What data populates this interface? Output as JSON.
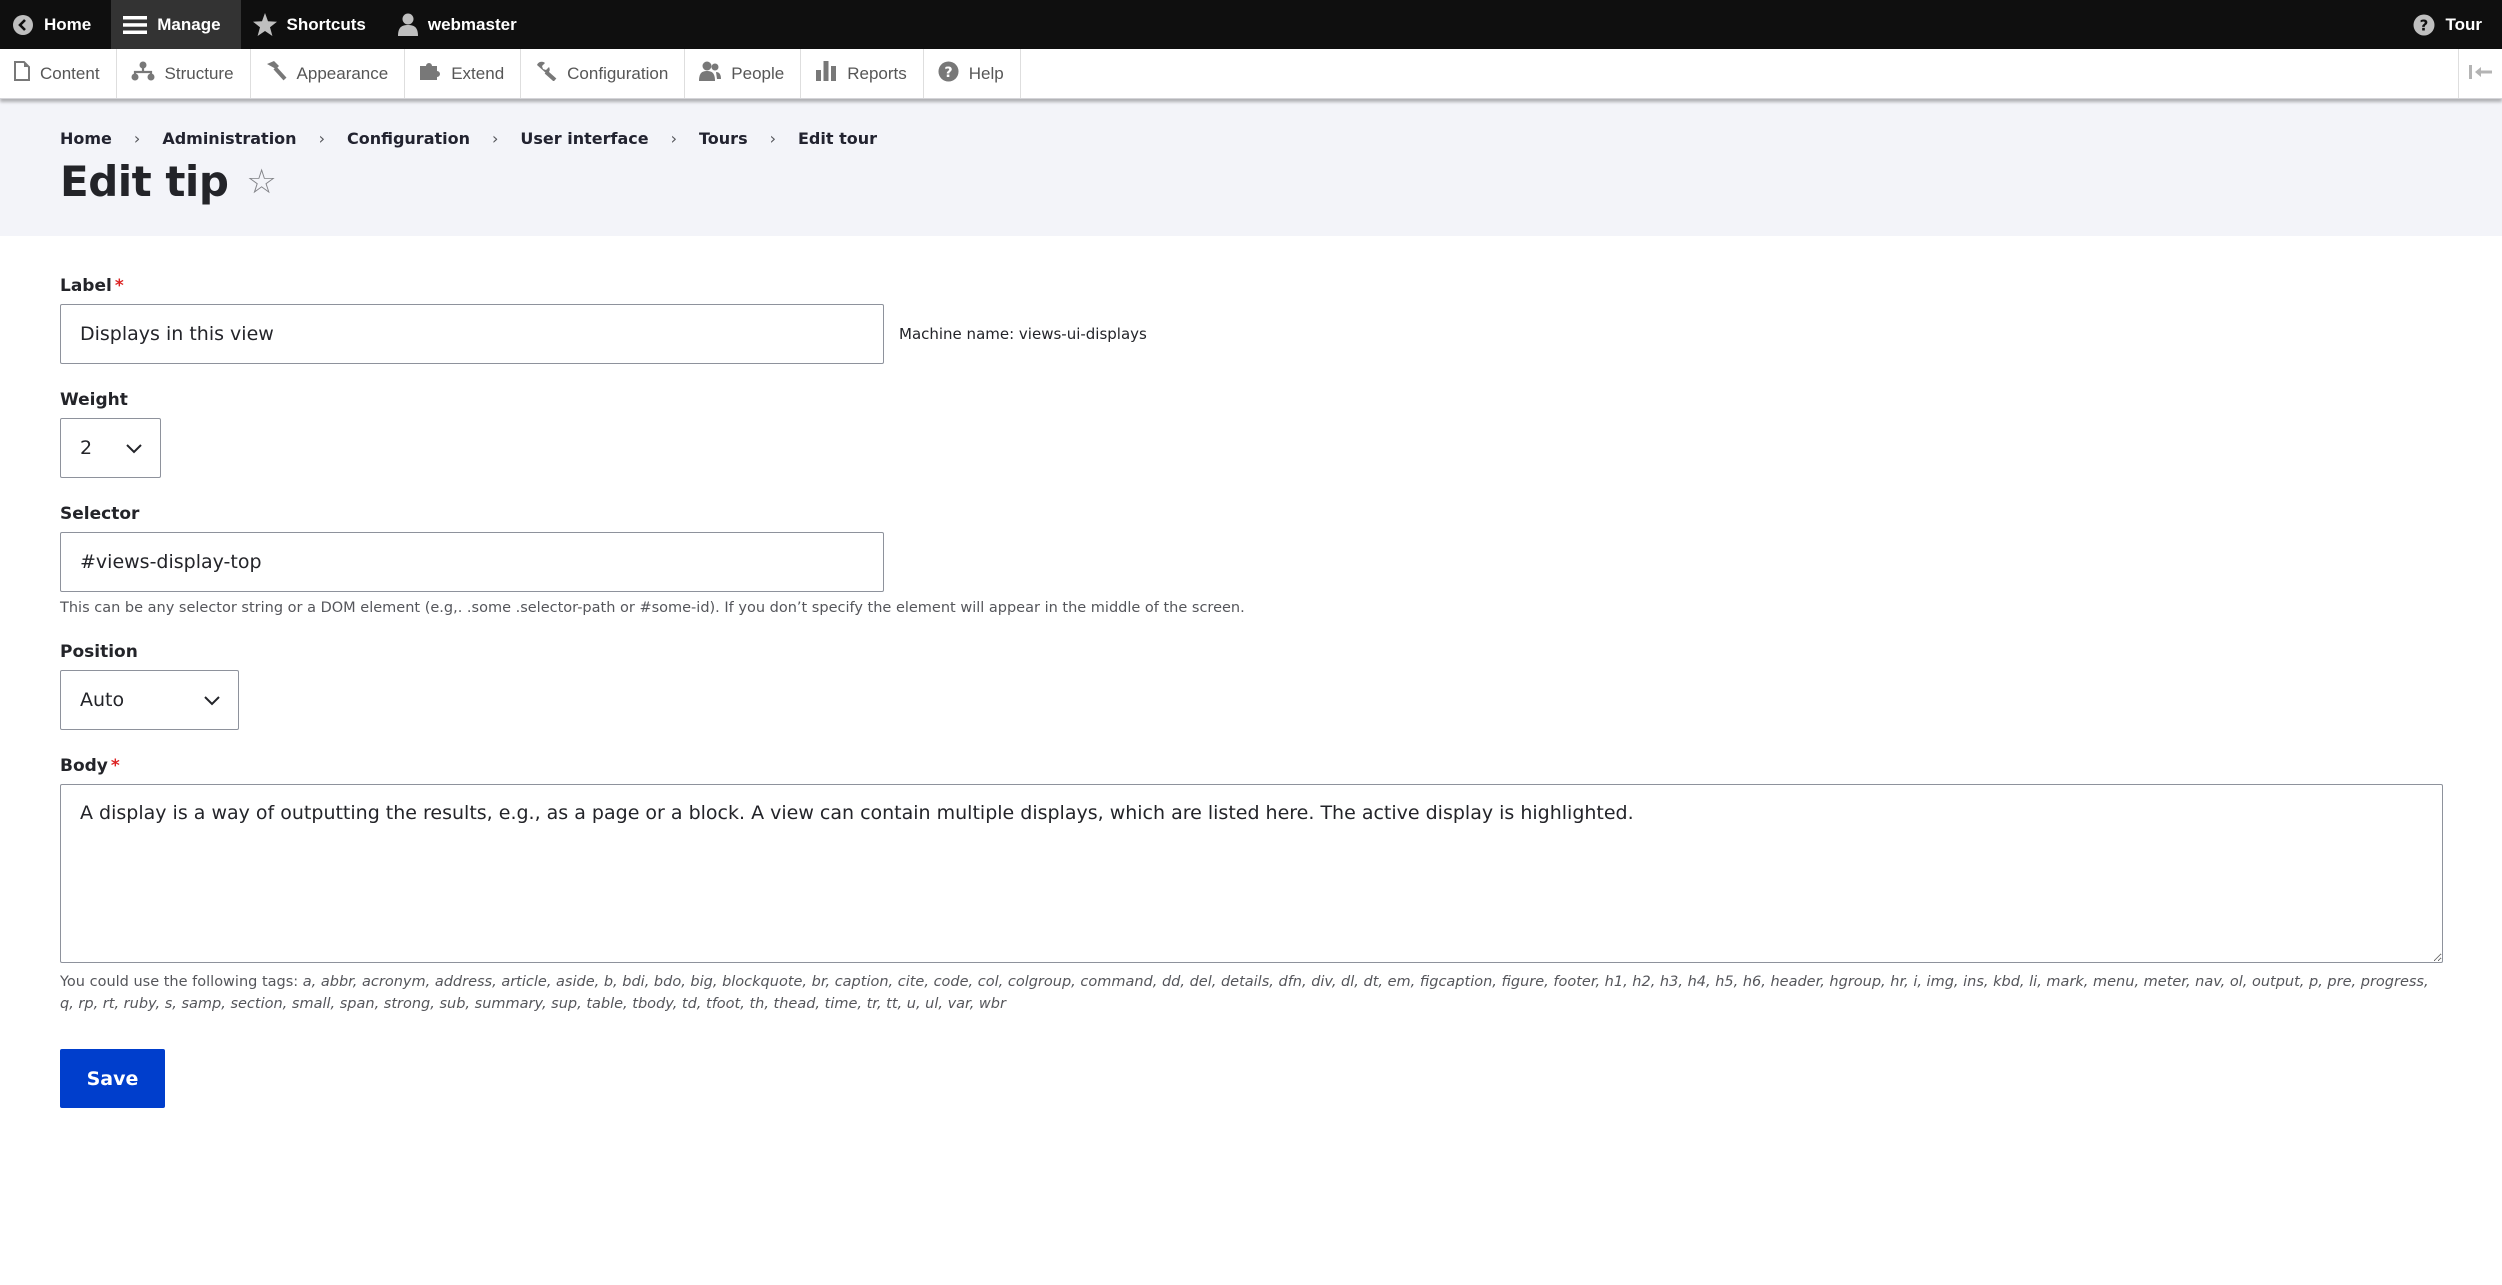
{
  "toolbar": {
    "home": "Home",
    "manage": "Manage",
    "shortcuts": "Shortcuts",
    "user": "webmaster",
    "tour": "Tour"
  },
  "tray": {
    "items": [
      {
        "label": "Content",
        "icon": "document-icon"
      },
      {
        "label": "Structure",
        "icon": "sitemap-icon"
      },
      {
        "label": "Appearance",
        "icon": "paintbrush-icon"
      },
      {
        "label": "Extend",
        "icon": "puzzle-icon"
      },
      {
        "label": "Configuration",
        "icon": "wrench-icon"
      },
      {
        "label": "People",
        "icon": "people-icon"
      },
      {
        "label": "Reports",
        "icon": "bar-chart-icon"
      },
      {
        "label": "Help",
        "icon": "help-icon"
      }
    ]
  },
  "breadcrumb": [
    "Home",
    "Administration",
    "Configuration",
    "User interface",
    "Tours",
    "Edit tour"
  ],
  "page_title": "Edit tip",
  "star_glyph": "☆",
  "form": {
    "label": {
      "title": "Label",
      "value": "Displays in this view",
      "machine_name": "Machine name: views-ui-displays"
    },
    "weight": {
      "title": "Weight",
      "value": "2"
    },
    "selector": {
      "title": "Selector",
      "value": "#views-display-top",
      "description": "This can be any selector string or a DOM element (e.g,. .some .selector-path or #some-id). If you don’t specify the element will appear in the middle of the screen."
    },
    "position": {
      "title": "Position",
      "value": "Auto"
    },
    "body": {
      "title": "Body",
      "value": "A display is a way of outputting the results, e.g., as a page or a block. A view can contain multiple displays, which are listed here. The active display is highlighted.",
      "tags_prefix": "You could use the following tags: ",
      "tags": "a, abbr, acronym, address, article, aside, b, bdi, bdo, big, blockquote, br, caption, cite, code, col, colgroup, command, dd, del, details, dfn, div, dl, dt, em, figcaption, figure, footer, h1, h2, h3, h4, h5, h6, header, hgroup, hr, i, img, ins, kbd, li, mark, menu, meter, nav, ol, output, p, pre, progress, q, rp, rt, ruby, s, samp, section, small, span, strong, sub, summary, sup, table, tbody, td, tfoot, th, thead, time, tr, tt, u, ul, var, wbr"
    },
    "required_mark": "*",
    "save": "Save"
  },
  "colors": {
    "toolbar_bg": "#0f0f0f",
    "manage_active_bg": "#333333",
    "header_bg": "#f3f4f9",
    "primary_button": "#003ecc",
    "required": "#dc2323"
  }
}
